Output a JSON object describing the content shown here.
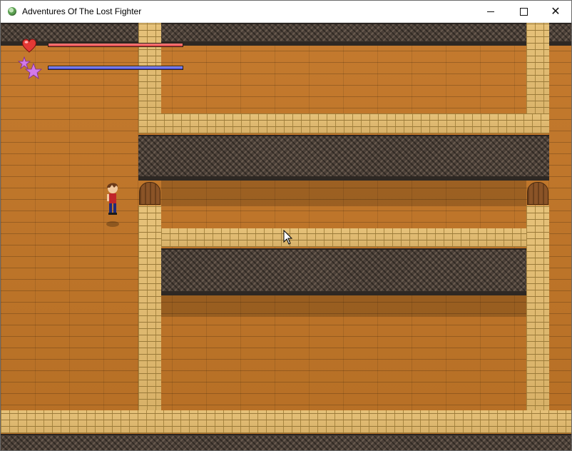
{
  "window": {
    "title": "Adventures Of The Lost Fighter",
    "controls": {
      "minimize": "minimize",
      "maximize": "maximize",
      "close": "✕"
    }
  },
  "hud": {
    "health": {
      "icon": "heart-icon",
      "fraction": 1.0,
      "color": "#d33a3a"
    },
    "mana": {
      "icon": "star-icon",
      "fraction": 1.0,
      "color": "#3a40c8"
    }
  },
  "scene": {
    "floor_color": "#c47a2e",
    "wall_color": "#4b4038",
    "brick_color": "#e6c27a"
  }
}
